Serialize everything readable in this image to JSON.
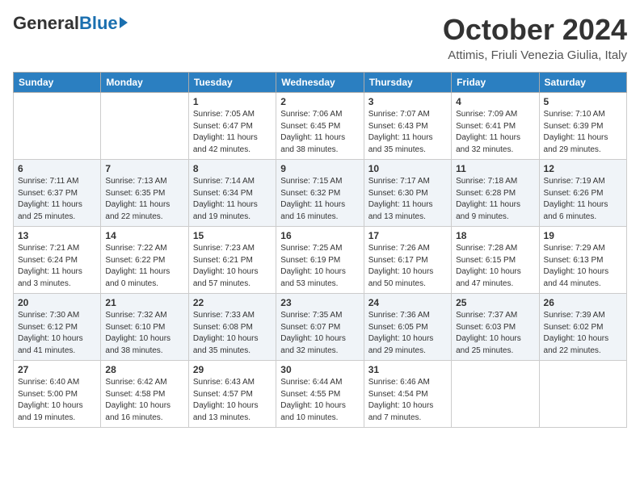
{
  "header": {
    "logo": {
      "general": "General",
      "blue": "Blue"
    },
    "title": "October 2024",
    "location": "Attimis, Friuli Venezia Giulia, Italy"
  },
  "days_of_week": [
    "Sunday",
    "Monday",
    "Tuesday",
    "Wednesday",
    "Thursday",
    "Friday",
    "Saturday"
  ],
  "weeks": [
    [
      {
        "day": "",
        "info": ""
      },
      {
        "day": "",
        "info": ""
      },
      {
        "day": "1",
        "info": "Sunrise: 7:05 AM\nSunset: 6:47 PM\nDaylight: 11 hours and 42 minutes."
      },
      {
        "day": "2",
        "info": "Sunrise: 7:06 AM\nSunset: 6:45 PM\nDaylight: 11 hours and 38 minutes."
      },
      {
        "day": "3",
        "info": "Sunrise: 7:07 AM\nSunset: 6:43 PM\nDaylight: 11 hours and 35 minutes."
      },
      {
        "day": "4",
        "info": "Sunrise: 7:09 AM\nSunset: 6:41 PM\nDaylight: 11 hours and 32 minutes."
      },
      {
        "day": "5",
        "info": "Sunrise: 7:10 AM\nSunset: 6:39 PM\nDaylight: 11 hours and 29 minutes."
      }
    ],
    [
      {
        "day": "6",
        "info": "Sunrise: 7:11 AM\nSunset: 6:37 PM\nDaylight: 11 hours and 25 minutes."
      },
      {
        "day": "7",
        "info": "Sunrise: 7:13 AM\nSunset: 6:35 PM\nDaylight: 11 hours and 22 minutes."
      },
      {
        "day": "8",
        "info": "Sunrise: 7:14 AM\nSunset: 6:34 PM\nDaylight: 11 hours and 19 minutes."
      },
      {
        "day": "9",
        "info": "Sunrise: 7:15 AM\nSunset: 6:32 PM\nDaylight: 11 hours and 16 minutes."
      },
      {
        "day": "10",
        "info": "Sunrise: 7:17 AM\nSunset: 6:30 PM\nDaylight: 11 hours and 13 minutes."
      },
      {
        "day": "11",
        "info": "Sunrise: 7:18 AM\nSunset: 6:28 PM\nDaylight: 11 hours and 9 minutes."
      },
      {
        "day": "12",
        "info": "Sunrise: 7:19 AM\nSunset: 6:26 PM\nDaylight: 11 hours and 6 minutes."
      }
    ],
    [
      {
        "day": "13",
        "info": "Sunrise: 7:21 AM\nSunset: 6:24 PM\nDaylight: 11 hours and 3 minutes."
      },
      {
        "day": "14",
        "info": "Sunrise: 7:22 AM\nSunset: 6:22 PM\nDaylight: 11 hours and 0 minutes."
      },
      {
        "day": "15",
        "info": "Sunrise: 7:23 AM\nSunset: 6:21 PM\nDaylight: 10 hours and 57 minutes."
      },
      {
        "day": "16",
        "info": "Sunrise: 7:25 AM\nSunset: 6:19 PM\nDaylight: 10 hours and 53 minutes."
      },
      {
        "day": "17",
        "info": "Sunrise: 7:26 AM\nSunset: 6:17 PM\nDaylight: 10 hours and 50 minutes."
      },
      {
        "day": "18",
        "info": "Sunrise: 7:28 AM\nSunset: 6:15 PM\nDaylight: 10 hours and 47 minutes."
      },
      {
        "day": "19",
        "info": "Sunrise: 7:29 AM\nSunset: 6:13 PM\nDaylight: 10 hours and 44 minutes."
      }
    ],
    [
      {
        "day": "20",
        "info": "Sunrise: 7:30 AM\nSunset: 6:12 PM\nDaylight: 10 hours and 41 minutes."
      },
      {
        "day": "21",
        "info": "Sunrise: 7:32 AM\nSunset: 6:10 PM\nDaylight: 10 hours and 38 minutes."
      },
      {
        "day": "22",
        "info": "Sunrise: 7:33 AM\nSunset: 6:08 PM\nDaylight: 10 hours and 35 minutes."
      },
      {
        "day": "23",
        "info": "Sunrise: 7:35 AM\nSunset: 6:07 PM\nDaylight: 10 hours and 32 minutes."
      },
      {
        "day": "24",
        "info": "Sunrise: 7:36 AM\nSunset: 6:05 PM\nDaylight: 10 hours and 29 minutes."
      },
      {
        "day": "25",
        "info": "Sunrise: 7:37 AM\nSunset: 6:03 PM\nDaylight: 10 hours and 25 minutes."
      },
      {
        "day": "26",
        "info": "Sunrise: 7:39 AM\nSunset: 6:02 PM\nDaylight: 10 hours and 22 minutes."
      }
    ],
    [
      {
        "day": "27",
        "info": "Sunrise: 6:40 AM\nSunset: 5:00 PM\nDaylight: 10 hours and 19 minutes."
      },
      {
        "day": "28",
        "info": "Sunrise: 6:42 AM\nSunset: 4:58 PM\nDaylight: 10 hours and 16 minutes."
      },
      {
        "day": "29",
        "info": "Sunrise: 6:43 AM\nSunset: 4:57 PM\nDaylight: 10 hours and 13 minutes."
      },
      {
        "day": "30",
        "info": "Sunrise: 6:44 AM\nSunset: 4:55 PM\nDaylight: 10 hours and 10 minutes."
      },
      {
        "day": "31",
        "info": "Sunrise: 6:46 AM\nSunset: 4:54 PM\nDaylight: 10 hours and 7 minutes."
      },
      {
        "day": "",
        "info": ""
      },
      {
        "day": "",
        "info": ""
      }
    ]
  ]
}
